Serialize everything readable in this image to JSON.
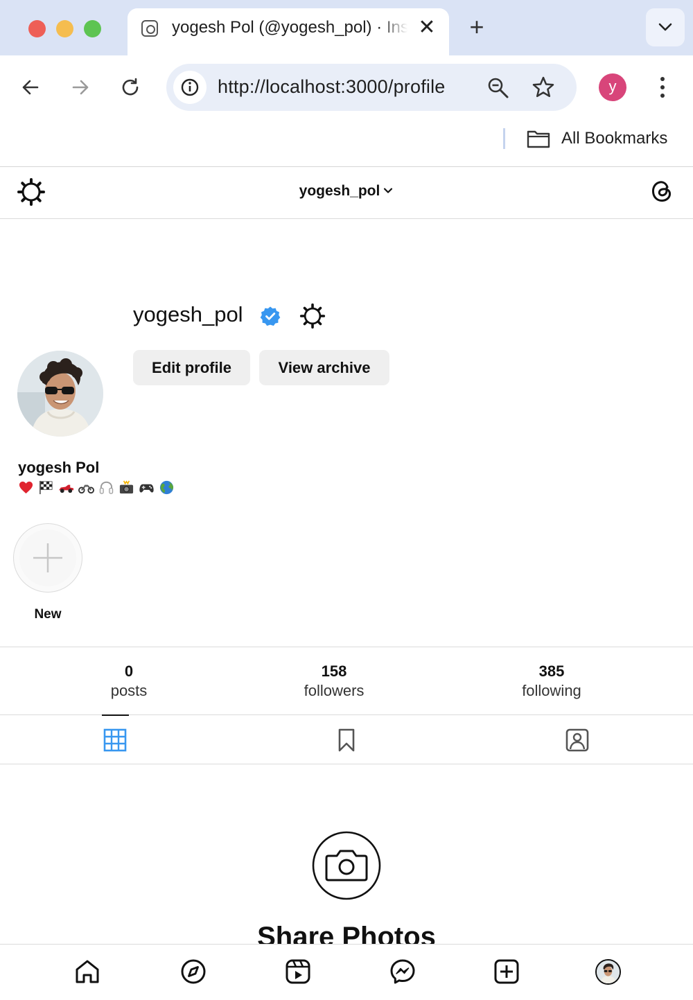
{
  "browser": {
    "tab_title": "yogesh Pol (@yogesh_pol) · Instagram",
    "new_tab_label": "+",
    "close_tab_label": "✕",
    "url": "http://localhost:3000/profile",
    "profile_initial": "y",
    "profile_color": "#d8457a",
    "bookmarks_label": "All Bookmarks"
  },
  "ig": {
    "header_username": "yogesh_pol",
    "profile": {
      "username": "yogesh_pol",
      "verified": true,
      "full_name": "yogesh Pol",
      "bio_emojis": [
        "heart",
        "checkered-flag",
        "race-car",
        "motorcycle",
        "headphones",
        "camera-flash",
        "game-controller",
        "globe"
      ],
      "edit_profile_label": "Edit profile",
      "view_archive_label": "View archive"
    },
    "highlights": {
      "new_label": "New"
    },
    "stats": {
      "posts_count": "0",
      "posts_label": "posts",
      "followers_count": "158",
      "followers_label": "followers",
      "following_count": "385",
      "following_label": "following"
    },
    "tabs": [
      "posts-grid",
      "saved",
      "tagged"
    ],
    "active_tab": "posts-grid",
    "empty_state_title": "Share Photos",
    "colors": {
      "accent_blue": "#3897f0",
      "verified_blue": "#3897f0",
      "button_bg": "#efefef"
    }
  }
}
